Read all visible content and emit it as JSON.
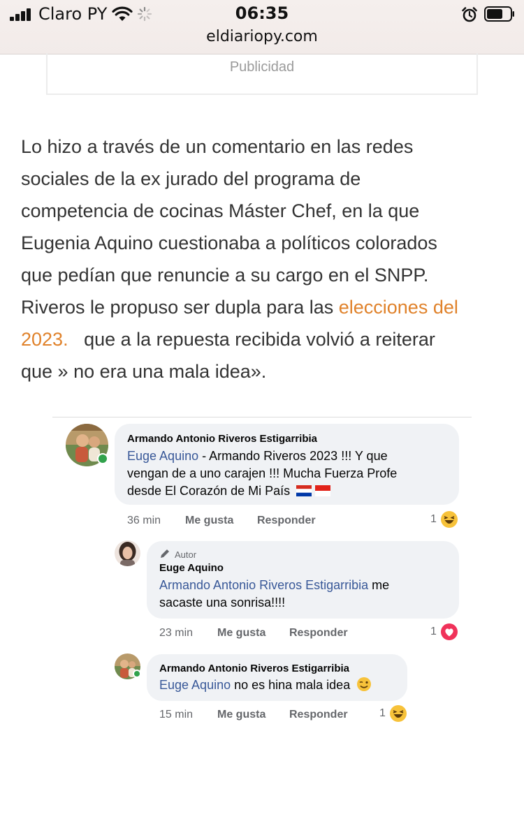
{
  "status_bar": {
    "carrier": "Claro PY",
    "time": "06:35"
  },
  "browser": {
    "url": "eldiariopy.com"
  },
  "ad": {
    "label": "Publicidad"
  },
  "article": {
    "lines": [
      "Lo hizo a través de un comentario en las redes",
      "sociales de la ex jurado del programa de",
      "competencia de cocinas Máster Chef, en la que",
      "Eugenia Aquino cuestionaba a políticos colorados",
      "que pedían que renuncie a su cargo en el SNPP.",
      "Riveros le propuso ser dupla para las ",
      "que a la repuesta recibida volvió a reiterar",
      "que » no era una mala idea»."
    ],
    "link_part1": "elecciones del",
    "link_part2": "2023.",
    "after_link": "   que a la repuesta recibida volvió a reiterar"
  },
  "comments": [
    {
      "author": "Armando Antonio Riveros Estigarribia",
      "mention": "Euge Aquino",
      "text_line1_rest": " - Armando Riveros 2023 !!! Y que",
      "text_line2": "vengan de a uno carajen !!! Mucha  Fuerza Profe",
      "text_line3": "desde El Corazón de Mi País",
      "time": "36 min",
      "like": "Me gusta",
      "reply": "Responder",
      "reaction_count": "1",
      "reaction": "haha"
    },
    {
      "badge": "Autor",
      "author": "Euge Aquino",
      "mention": "Armando Antonio Riveros Estigarribia",
      "text_line1_rest": " me",
      "text_line2": "sacaste una sonrisa!!!!",
      "time": "23 min",
      "like": "Me gusta",
      "reply": "Responder",
      "reaction_count": "1",
      "reaction": "love"
    },
    {
      "author": "Armando Antonio Riveros Estigarribia",
      "mention": "Euge Aquino",
      "text_line1_rest": " no es hina mala idea",
      "time": "15 min",
      "like": "Me gusta",
      "reply": "Responder",
      "reaction_count": "1",
      "reaction": "haha"
    }
  ],
  "colors": {
    "link_orange": "#e0822b",
    "fb_mention_blue": "#385898",
    "bubble_gray": "#f0f2f5",
    "online_green": "#31a24c"
  }
}
